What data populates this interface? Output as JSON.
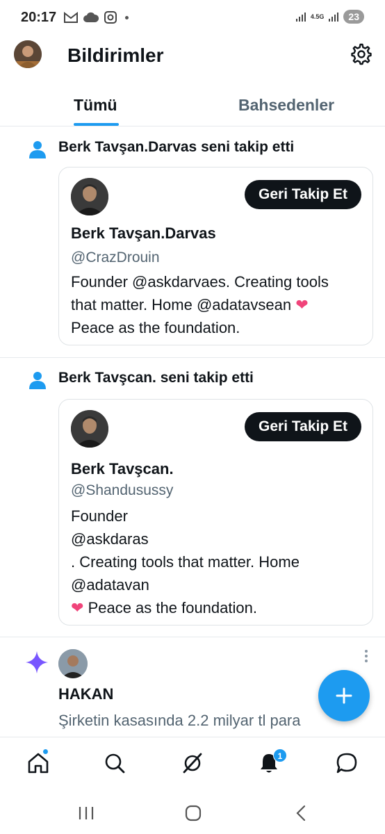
{
  "status_bar": {
    "time": "20:17",
    "network": "4.5G",
    "battery": "23"
  },
  "header": {
    "title": "Bildirimler"
  },
  "tabs": [
    {
      "label": "Tümü",
      "active": true
    },
    {
      "label": "Bahsedenler",
      "active": false
    }
  ],
  "notifications": [
    {
      "text": "Berk Tavşan.Darvas seni takip etti",
      "card": {
        "button_label": "Geri Takip Et",
        "name": "Berk Tavşan.Darvas",
        "handle": "@CrazDrouin",
        "bio_lines": [
          "Founder @askdarvaes. Creating tools",
          "that matter. Home @adatavsean",
          "Peace as the foundation."
        ]
      }
    },
    {
      "text": "Berk Tavşcan. seni takip etti",
      "card": {
        "button_label": "Geri Takip Et",
        "name": "Berk Tavşcan.",
        "handle": "@Shandusussy",
        "bio_lines": [
          "Founder",
          "@askdaras",
          ". Creating tools that matter. Home",
          "@adatavan",
          "Peace as the foundation."
        ]
      }
    },
    {
      "name": "HAKAN",
      "text": "Şirketin kasasında 2.2 milyar tl para"
    }
  ],
  "bottom_nav": {
    "items": [
      "home-icon",
      "search-icon",
      "grok-icon",
      "bell-icon",
      "messages-icon"
    ],
    "notification_count": "1"
  },
  "colors": {
    "accent": "#1d9bf0",
    "text": "#0f1419",
    "secondary": "#536471",
    "heart": "#f0447a",
    "spark": "#7856ff"
  }
}
